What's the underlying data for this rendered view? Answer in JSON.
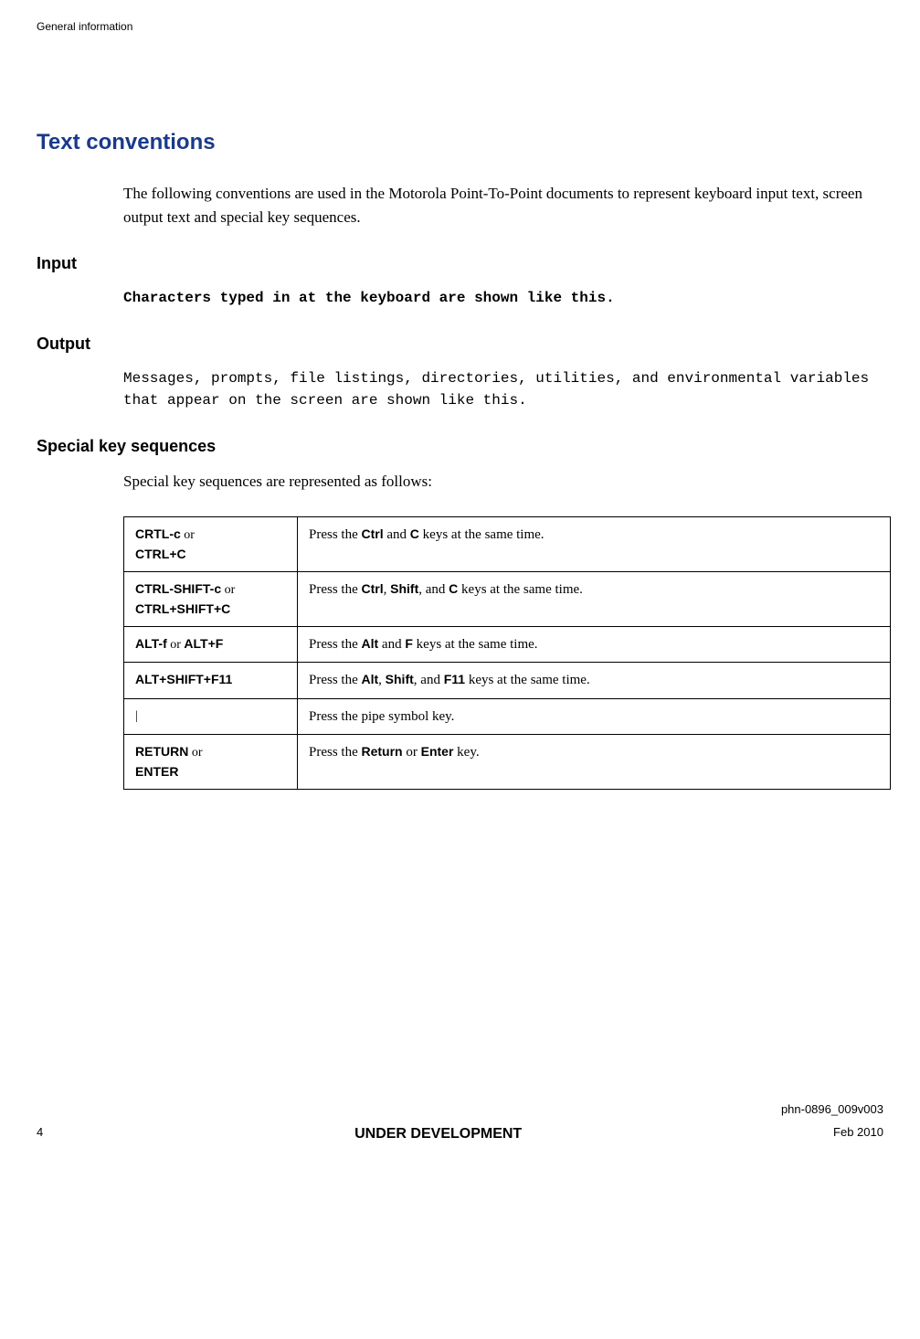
{
  "header": "General information",
  "title": "Text conventions",
  "intro": "The following conventions are used in the Motorola Point-To-Point documents to represent keyboard input text, screen output text and special key sequences.",
  "sections": {
    "input": {
      "heading": "Input",
      "text": "Characters typed in at the keyboard are shown like this."
    },
    "output": {
      "heading": "Output",
      "text": "Messages, prompts, file listings, directories, utilities, and environmental variables that appear on the screen are shown like this."
    },
    "special": {
      "heading": "Special key sequences",
      "intro": "Special key sequences are represented as follows:"
    }
  },
  "table": [
    {
      "key1": "CRTL-c",
      "or": " or ",
      "key2": "CTRL+C",
      "desc_pre": "Press the ",
      "d1": "Ctrl",
      "mid1": " and ",
      "d2": "C",
      "desc_post": " keys at the same time."
    },
    {
      "key1": "CTRL-SHIFT-c",
      "or": " or ",
      "key2": "CTRL+SHIFT+C",
      "desc_pre": "Press the ",
      "d1": "Ctrl",
      "mid1": ", ",
      "d2": "Shift",
      "mid2": ", and ",
      "d3": "C",
      "desc_post": " keys at the same time."
    },
    {
      "key1": "ALT-f",
      "or": " or ",
      "key2": "ALT+F",
      "desc_pre": "Press the ",
      "d1": "Alt",
      "mid1": " and ",
      "d2": "F",
      "desc_post": " keys at the same time."
    },
    {
      "key1": "ALT+SHIFT+F11",
      "desc_pre": "Press the ",
      "d1": "Alt",
      "mid1": ", ",
      "d2": "Shift",
      "mid2": ", and ",
      "d3": "F11",
      "desc_post": " keys at the same time."
    },
    {
      "key1": "|",
      "desc_pre": "Press the pipe symbol key."
    },
    {
      "key1": "RETURN",
      "or": " or ",
      "key2": "ENTER",
      "desc_pre": "Press the ",
      "d1": "Return",
      "mid1": " or ",
      "d2": "Enter",
      "desc_post": " key."
    }
  ],
  "footer": {
    "doc_id": "phn-0896_009v003",
    "page": "4",
    "status": "UNDER DEVELOPMENT",
    "date": "Feb 2010"
  }
}
